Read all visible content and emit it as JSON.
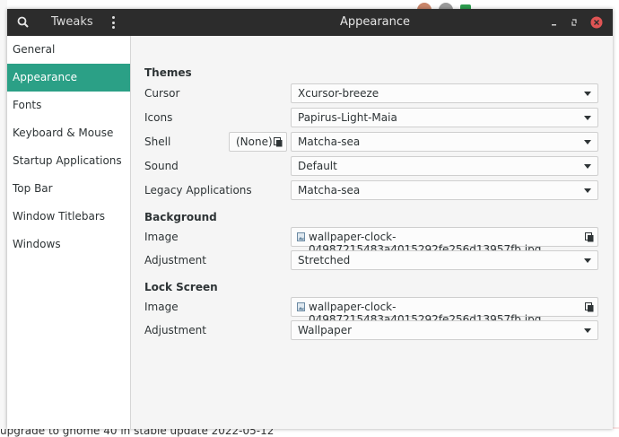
{
  "window": {
    "app_name": "Tweaks",
    "title": "Appearance",
    "icons": {
      "search": "search-icon",
      "menu": "menu-icon",
      "minimize": "minimize-icon",
      "maximize": "maximize-icon",
      "close": "close-icon"
    },
    "accent": "#2ba086",
    "close_color": "#e05454"
  },
  "sidebar": {
    "items": [
      {
        "label": "General"
      },
      {
        "label": "Appearance",
        "active": true
      },
      {
        "label": "Fonts"
      },
      {
        "label": "Keyboard & Mouse"
      },
      {
        "label": "Startup Applications"
      },
      {
        "label": "Top Bar"
      },
      {
        "label": "Window Titlebars"
      },
      {
        "label": "Windows"
      }
    ]
  },
  "themes": {
    "heading": "Themes",
    "cursor_label": "Cursor",
    "cursor_value": "Xcursor-breeze",
    "icons_label": "Icons",
    "icons_value": "Papirus-Light-Maia",
    "shell_label": "Shell",
    "shell_button": "(None)",
    "shell_value": "Matcha-sea",
    "sound_label": "Sound",
    "sound_value": "Default",
    "legacy_label": "Legacy Applications",
    "legacy_value": "Matcha-sea"
  },
  "background": {
    "heading": "Background",
    "image_label": "Image",
    "image_value": "wallpaper-clock-04987215483a4015292fe256d13957fb.jpg",
    "adjustment_label": "Adjustment",
    "adjustment_value": "Stretched"
  },
  "lock_screen": {
    "heading": "Lock Screen",
    "image_label": "Image",
    "image_value": "wallpaper-clock-04987215483a4015292fe256d13957fb.jpg",
    "adjustment_label": "Adjustment",
    "adjustment_value": "Wallpaper"
  },
  "background_page": {
    "bottom_text": "upgrade to gnome 40 in stable update 2022-05-12"
  }
}
